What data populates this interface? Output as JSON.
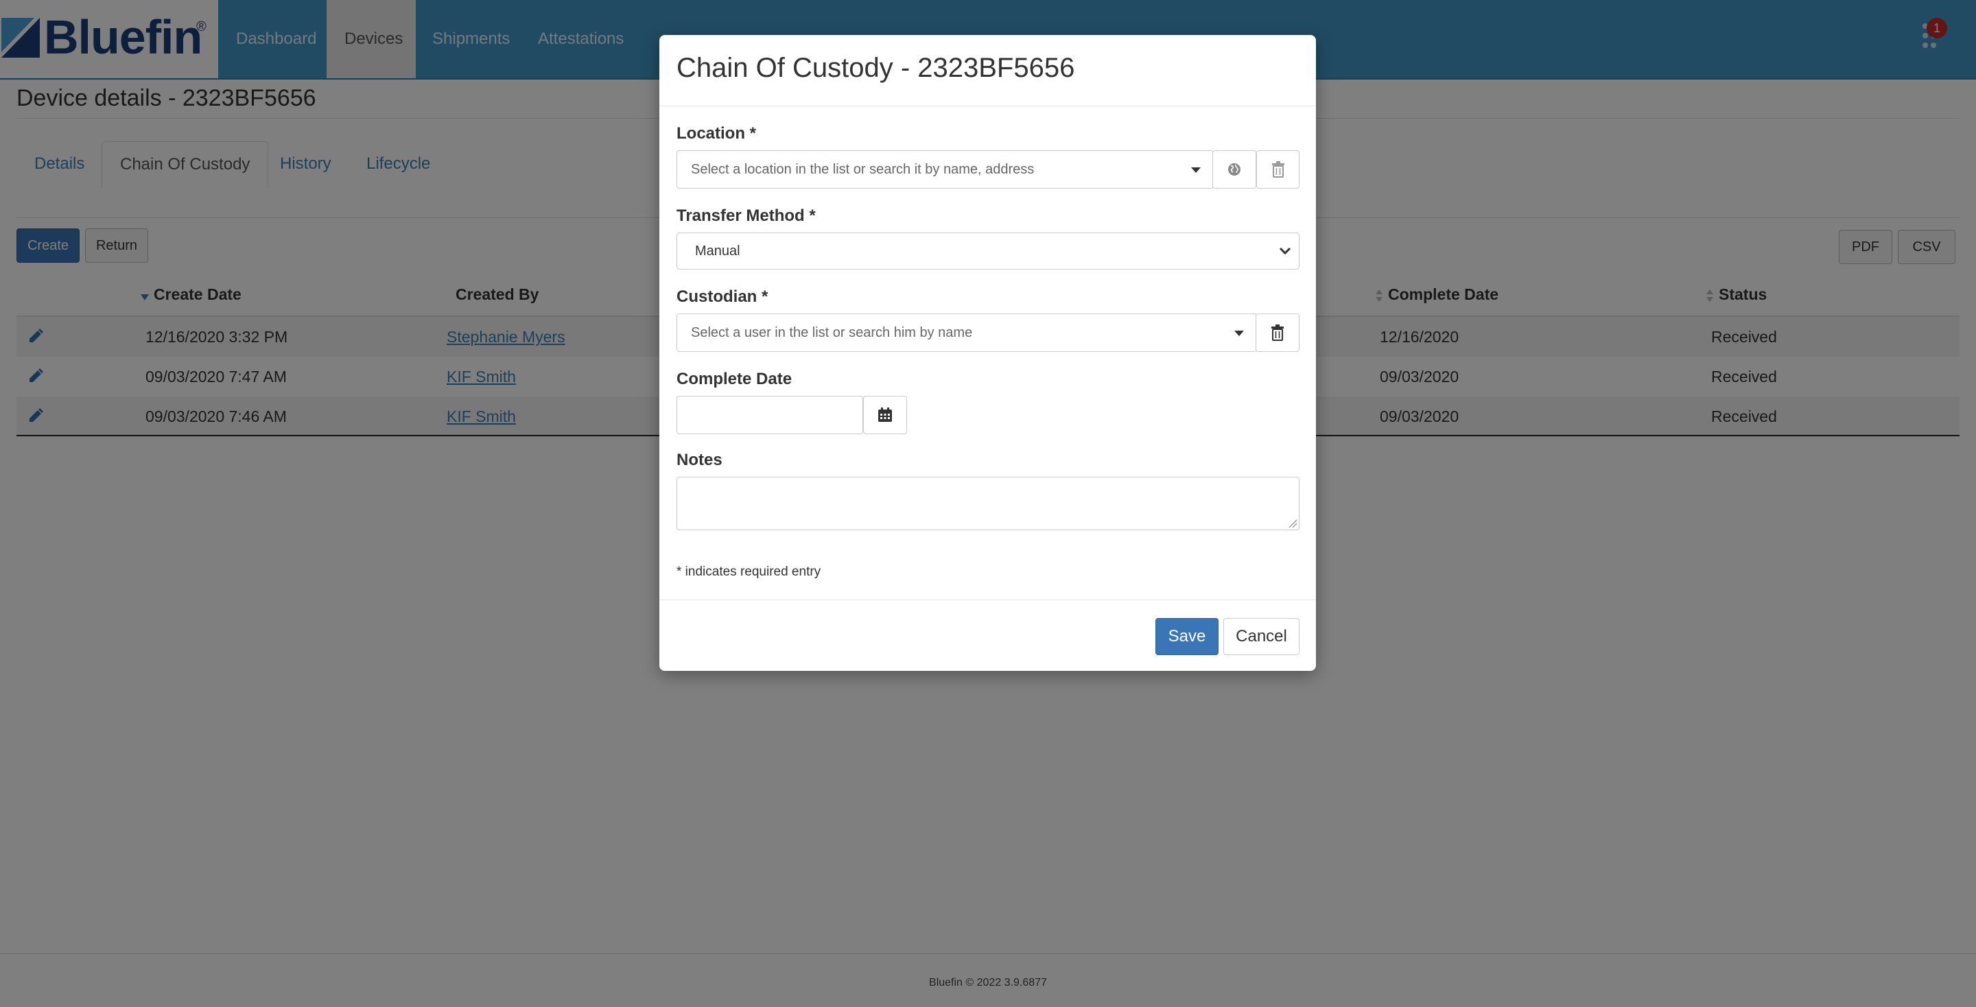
{
  "brand": {
    "name": "Bluefin",
    "reg": "®"
  },
  "nav": {
    "items": [
      {
        "label": "Dashboard"
      },
      {
        "label": "Devices"
      },
      {
        "label": "Shipments"
      },
      {
        "label": "Attestations"
      }
    ],
    "notification_count": "1"
  },
  "page": {
    "title": "Device details - 2323BF5656",
    "tabs": [
      {
        "label": "Details"
      },
      {
        "label": "Chain Of Custody"
      },
      {
        "label": "History"
      },
      {
        "label": "Lifecycle"
      }
    ],
    "buttons": {
      "create": "Create",
      "return": "Return",
      "pdf": "PDF",
      "csv": "CSV"
    }
  },
  "table": {
    "headers": {
      "create_date": "Create Date",
      "created_by": "Created By",
      "complete_date": "Complete Date",
      "status": "Status"
    },
    "rows": [
      {
        "create_date": "12/16/2020 3:32 PM",
        "created_by": "Stephanie Myers",
        "complete_date": "12/16/2020",
        "status": "Received"
      },
      {
        "create_date": "09/03/2020 7:47 AM",
        "created_by": "KIF Smith",
        "complete_date": "09/03/2020",
        "status": "Received"
      },
      {
        "create_date": "09/03/2020 7:46 AM",
        "created_by": "KIF Smith",
        "complete_date": "09/03/2020",
        "status": "Received"
      }
    ]
  },
  "footer": {
    "text": "Bluefin © 2022 3.9.6877"
  },
  "modal": {
    "title": "Chain Of Custody - 2323BF5656",
    "location": {
      "label": "Location *",
      "placeholder": "Select a location in the list or search it by name, address"
    },
    "transfer_method": {
      "label": "Transfer Method *",
      "value": "Manual"
    },
    "custodian": {
      "label": "Custodian *",
      "placeholder": "Select a user in the list or search him by name"
    },
    "complete_date": {
      "label": "Complete Date",
      "value": ""
    },
    "notes": {
      "label": "Notes",
      "value": ""
    },
    "required_note": "* indicates required entry",
    "save": "Save",
    "cancel": "Cancel"
  }
}
